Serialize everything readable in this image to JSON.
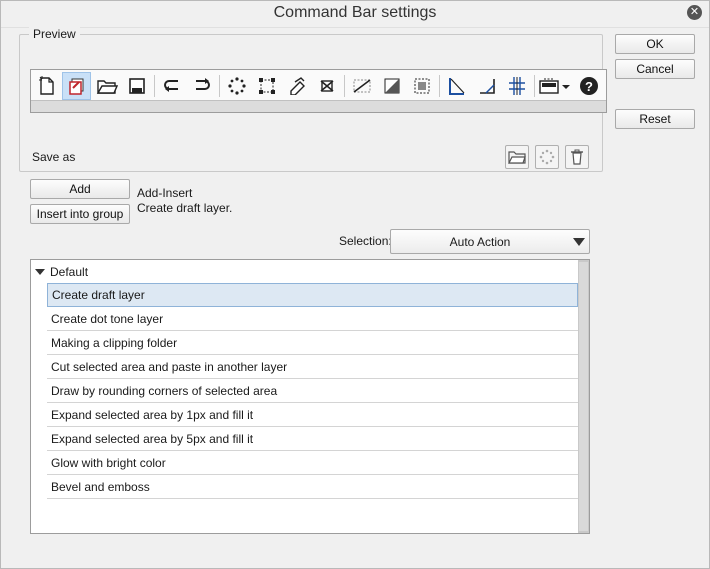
{
  "window": {
    "title": "Command Bar settings"
  },
  "buttons": {
    "ok": "OK",
    "cancel": "Cancel",
    "reset": "Reset",
    "add": "Add",
    "insert_group": "Insert into group"
  },
  "preview": {
    "legend": "Preview",
    "save_as": "Save as",
    "toolbar_icons": [
      "new-file-icon",
      "create-layer-icon",
      "open-folder-icon",
      "save-icon",
      "undo-icon",
      "redo-icon",
      "dots-icon",
      "transform-icon",
      "eraser-icon",
      "scale-icon",
      "line-icon",
      "gradient-icon",
      "selection-icon",
      "ruler-icon",
      "angle-icon",
      "grid-icon",
      "dropdown-icon",
      "help-icon"
    ]
  },
  "info": {
    "line1": "Add-Insert",
    "line2": "Create draft layer."
  },
  "selection": {
    "label": "Selection:",
    "value": "Auto Action"
  },
  "list": {
    "group": "Default",
    "items": [
      "Create draft layer",
      "Create dot tone layer",
      "Making a clipping folder",
      "Cut selected area and paste in another layer",
      "Draw by rounding corners of selected area",
      "Expand selected area by 1px and fill it",
      "Expand selected area by 5px and fill it",
      "Glow with bright color",
      "Bevel and emboss"
    ]
  }
}
